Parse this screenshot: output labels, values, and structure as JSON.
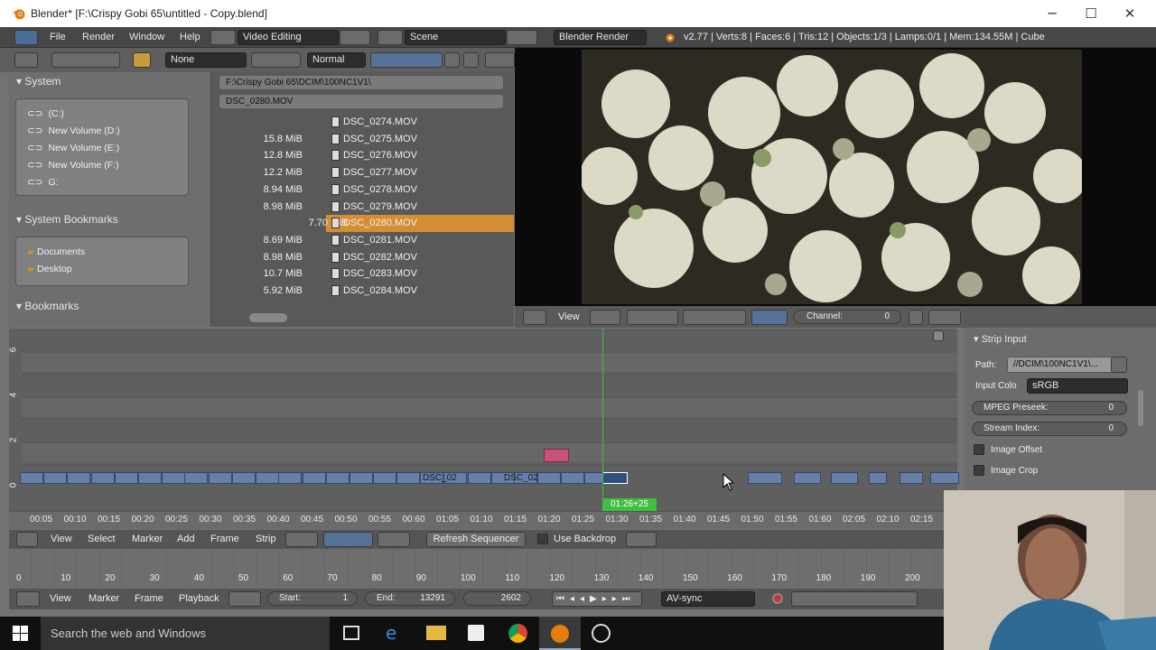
{
  "window": {
    "title": "Blender* [F:\\Crispy Gobi 65\\untitled - Copy.blend]",
    "minimize": "─",
    "maximize": "☐",
    "close": "✕"
  },
  "infobar": {
    "menus": [
      "File",
      "Render",
      "Window",
      "Help"
    ],
    "screen": "Video Editing",
    "scene": "Scene",
    "engine": "Blender Render",
    "stats": "v2.77 | Verts:8 | Faces:6 | Tris:12 | Objects:1/3 | Lamps:0/1 | Mem:134.55M | Cube"
  },
  "filebrowser": {
    "filter_none": "None",
    "display": "Normal",
    "system_header": "System",
    "volumes": [
      "(C:)",
      "New Volume (D:)",
      "New Volume (E:)",
      "New Volume (F:)",
      "G:"
    ],
    "bookmarks_header": "System Bookmarks",
    "bookmarks": [
      "Documents",
      "Desktop"
    ],
    "recent_header": "Bookmarks",
    "directory": "F:\\Crispy Gobi 65\\DCIM\\100NC1V1\\",
    "filename": "DSC_0280.MOV",
    "files": [
      {
        "size": "",
        "name": "DSC_0274.MOV"
      },
      {
        "size": "15.8 MiB",
        "name": "DSC_0275.MOV"
      },
      {
        "size": "12.8 MiB",
        "name": "DSC_0276.MOV"
      },
      {
        "size": "12.2 MiB",
        "name": "DSC_0277.MOV"
      },
      {
        "size": "8.94 MiB",
        "name": "DSC_0278.MOV"
      },
      {
        "size": "8.98 MiB",
        "name": "DSC_0279.MOV"
      },
      {
        "size": "7.70 MiB",
        "name": "DSC_0280.MOV",
        "selected": true
      },
      {
        "size": "8.69 MiB",
        "name": "DSC_0281.MOV"
      },
      {
        "size": "8.98 MiB",
        "name": "DSC_0282.MOV"
      },
      {
        "size": "10.7 MiB",
        "name": "DSC_0283.MOV"
      },
      {
        "size": "5.92 MiB",
        "name": "DSC_0284.MOV"
      }
    ]
  },
  "preview_bar": {
    "view": "View",
    "channel_label": "Channel:",
    "channel_value": "0"
  },
  "sequencer": {
    "strip_labels": [
      "DSC_02",
      "DSC_02"
    ],
    "current_time": "01:26+25",
    "channels": [
      "6",
      "4",
      "2",
      "0"
    ],
    "time_ticks": [
      "00:05",
      "00:10",
      "00:15",
      "00:20",
      "00:25",
      "00:30",
      "00:35",
      "00:40",
      "00:45",
      "00:50",
      "00:55",
      "00:60",
      "01:05",
      "01:10",
      "01:15",
      "01:20",
      "01:25",
      "01:30",
      "01:35",
      "01:40",
      "01:45",
      "01:50",
      "01:55",
      "01:60",
      "02:05",
      "02:10",
      "02:15"
    ],
    "menu": [
      "View",
      "Select",
      "Marker",
      "Add",
      "Frame",
      "Strip"
    ],
    "refresh": "Refresh Sequencer",
    "backdrop": "Use Backdrop"
  },
  "props": {
    "header": "Strip Input",
    "path_label": "Path:",
    "path_value": "//DCIM\\100NC1V1\\...",
    "colorspace_label": "Input Colo",
    "colorspace_value": "sRGB",
    "preseek_label": "MPEG Preseek:",
    "preseek_value": "0",
    "stream_label": "Stream Index:",
    "stream_value": "0",
    "offset_label": "Image Offset",
    "crop_label": "Image Crop"
  },
  "timeline": {
    "ticks": [
      "0",
      "10",
      "20",
      "30",
      "40",
      "50",
      "60",
      "70",
      "80",
      "90",
      "100",
      "110",
      "120",
      "130",
      "140",
      "150",
      "160",
      "170",
      "180",
      "190",
      "200"
    ],
    "menu": [
      "View",
      "Marker",
      "Frame",
      "Playback"
    ],
    "start_label": "Start:",
    "start_value": "1",
    "end_label": "End:",
    "end_value": "13291",
    "current": "2602",
    "sync": "AV-sync"
  },
  "taskbar": {
    "search": "Search the web and Windows"
  },
  "colors": {
    "accent": "#d58e32",
    "playhead": "#3fbf3f",
    "strip": "#667fa8",
    "strip_meta": "#c8507a"
  }
}
